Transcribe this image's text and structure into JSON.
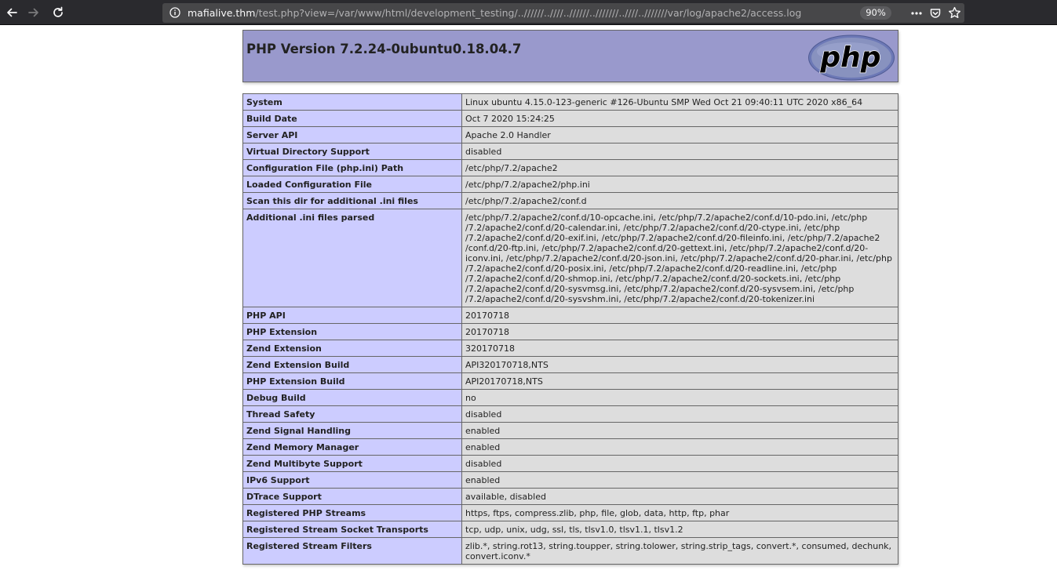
{
  "browser": {
    "url_host": "mafialive.thm",
    "url_path": "/test.php?view=/var/www/html/development_testing/..//////..////..//////..///////..////..///////var/log/apache2/access.log",
    "zoom": "90%",
    "colors": {
      "toolbar": "#2a2a2e",
      "urlbar": "#474749"
    }
  },
  "phpinfo": {
    "title": "PHP Version 7.2.24-0ubuntu0.18.04.7",
    "logo_text": "php",
    "colors": {
      "header_bg": "#9999cc",
      "label_bg": "#ccccff",
      "value_bg": "#dddddd"
    },
    "rows": [
      {
        "label": "System",
        "value": "Linux ubuntu 4.15.0-123-generic #126-Ubuntu SMP Wed Oct 21 09:40:11 UTC 2020 x86_64"
      },
      {
        "label": "Build Date",
        "value": "Oct 7 2020 15:24:25"
      },
      {
        "label": "Server API",
        "value": "Apache 2.0 Handler"
      },
      {
        "label": "Virtual Directory Support",
        "value": "disabled"
      },
      {
        "label": "Configuration File (php.ini) Path",
        "value": "/etc/php/7.2/apache2"
      },
      {
        "label": "Loaded Configuration File",
        "value": "/etc/php/7.2/apache2/php.ini"
      },
      {
        "label": "Scan this dir for additional .ini files",
        "value": "/etc/php/7.2/apache2/conf.d"
      },
      {
        "label": "Additional .ini files parsed",
        "value": "/etc/php/7.2/apache2/conf.d/10-opcache.ini, /etc/php/7.2/apache2/conf.d/10-pdo.ini, /etc/php /7.2/apache2/conf.d/20-calendar.ini, /etc/php/7.2/apache2/conf.d/20-ctype.ini, /etc/php /7.2/apache2/conf.d/20-exif.ini, /etc/php/7.2/apache2/conf.d/20-fileinfo.ini, /etc/php/7.2/apache2 /conf.d/20-ftp.ini, /etc/php/7.2/apache2/conf.d/20-gettext.ini, /etc/php/7.2/apache2/conf.d/20- iconv.ini, /etc/php/7.2/apache2/conf.d/20-json.ini, /etc/php/7.2/apache2/conf.d/20-phar.ini, /etc/php /7.2/apache2/conf.d/20-posix.ini, /etc/php/7.2/apache2/conf.d/20-readline.ini, /etc/php /7.2/apache2/conf.d/20-shmop.ini, /etc/php/7.2/apache2/conf.d/20-sockets.ini, /etc/php /7.2/apache2/conf.d/20-sysvmsg.ini, /etc/php/7.2/apache2/conf.d/20-sysvsem.ini, /etc/php /7.2/apache2/conf.d/20-sysvshm.ini, /etc/php/7.2/apache2/conf.d/20-tokenizer.ini"
      },
      {
        "label": "PHP API",
        "value": "20170718"
      },
      {
        "label": "PHP Extension",
        "value": "20170718"
      },
      {
        "label": "Zend Extension",
        "value": "320170718"
      },
      {
        "label": "Zend Extension Build",
        "value": "API320170718,NTS"
      },
      {
        "label": "PHP Extension Build",
        "value": "API20170718,NTS"
      },
      {
        "label": "Debug Build",
        "value": "no"
      },
      {
        "label": "Thread Safety",
        "value": "disabled"
      },
      {
        "label": "Zend Signal Handling",
        "value": "enabled"
      },
      {
        "label": "Zend Memory Manager",
        "value": "enabled"
      },
      {
        "label": "Zend Multibyte Support",
        "value": "disabled"
      },
      {
        "label": "IPv6 Support",
        "value": "enabled"
      },
      {
        "label": "DTrace Support",
        "value": "available, disabled"
      },
      {
        "label": "Registered PHP Streams",
        "value": "https, ftps, compress.zlib, php, file, glob, data, http, ftp, phar"
      },
      {
        "label": "Registered Stream Socket Transports",
        "value": "tcp, udp, unix, udg, ssl, tls, tlsv1.0, tlsv1.1, tlsv1.2"
      },
      {
        "label": "Registered Stream Filters",
        "value": "zlib.*, string.rot13, string.toupper, string.tolower, string.strip_tags, convert.*, consumed, dechunk, convert.iconv.*"
      }
    ]
  }
}
